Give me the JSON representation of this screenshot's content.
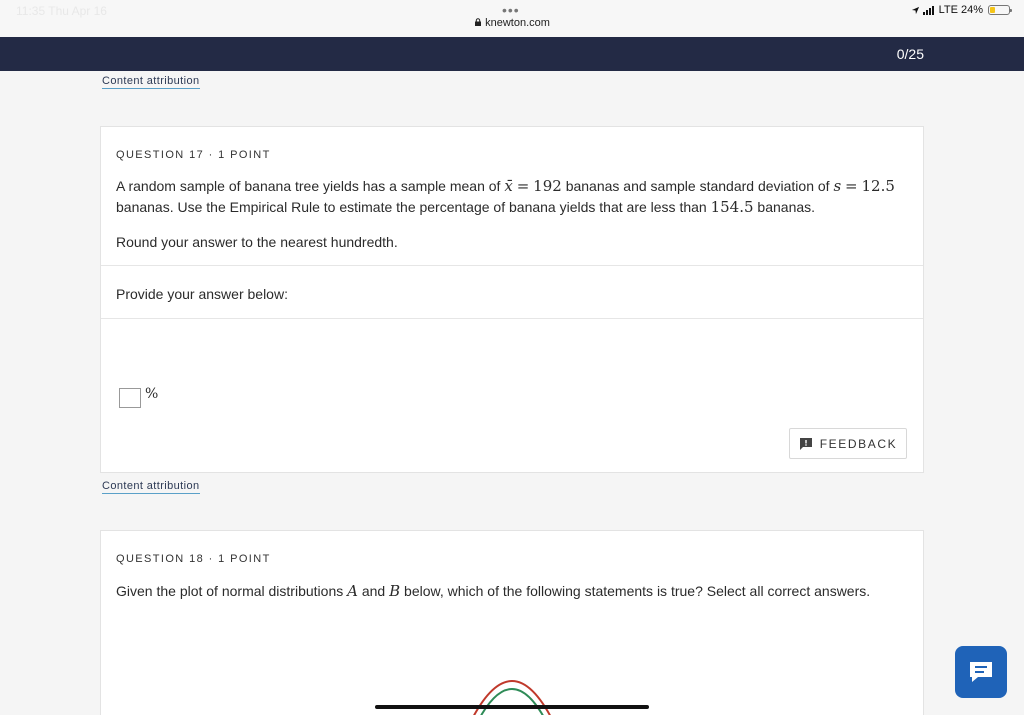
{
  "status": {
    "time": "11:35 Thu Apr 16",
    "url": "knewton.com",
    "carrier": "LTE",
    "battery": "24%"
  },
  "topbar": {
    "progress": "0/25"
  },
  "attribution_label": "Content attribution",
  "question17": {
    "header": "QUESTION 17 · 1 POINT",
    "text_part1": "A random sample of banana tree yields has a sample mean of",
    "xbar": "x̄",
    "eq": "=",
    "mean": "192",
    "text_part2": "bananas and sample standard deviation of",
    "s": "s",
    "sd": "12.5",
    "text_part3": "bananas.  Use the Empirical Rule to estimate the percentage of banana yields that are less than",
    "threshold": "154.5",
    "text_part4": "bananas.",
    "round_note": "Round your answer to the nearest hundredth.",
    "provide_label": "Provide your answer below:",
    "unit": "%",
    "feedback_label": "FEEDBACK"
  },
  "question18": {
    "header": "QUESTION 18 · 1 POINT",
    "text_part1": "Given the plot of normal distributions",
    "a": "A",
    "and": "and",
    "b": "B",
    "text_part2": "below, which of the following statements is true? Select all correct answers."
  },
  "colors": {
    "topbar": "#232a45",
    "curve_a": "#c0392b",
    "curve_b": "#2e8b57",
    "chat": "#1f63b8"
  }
}
